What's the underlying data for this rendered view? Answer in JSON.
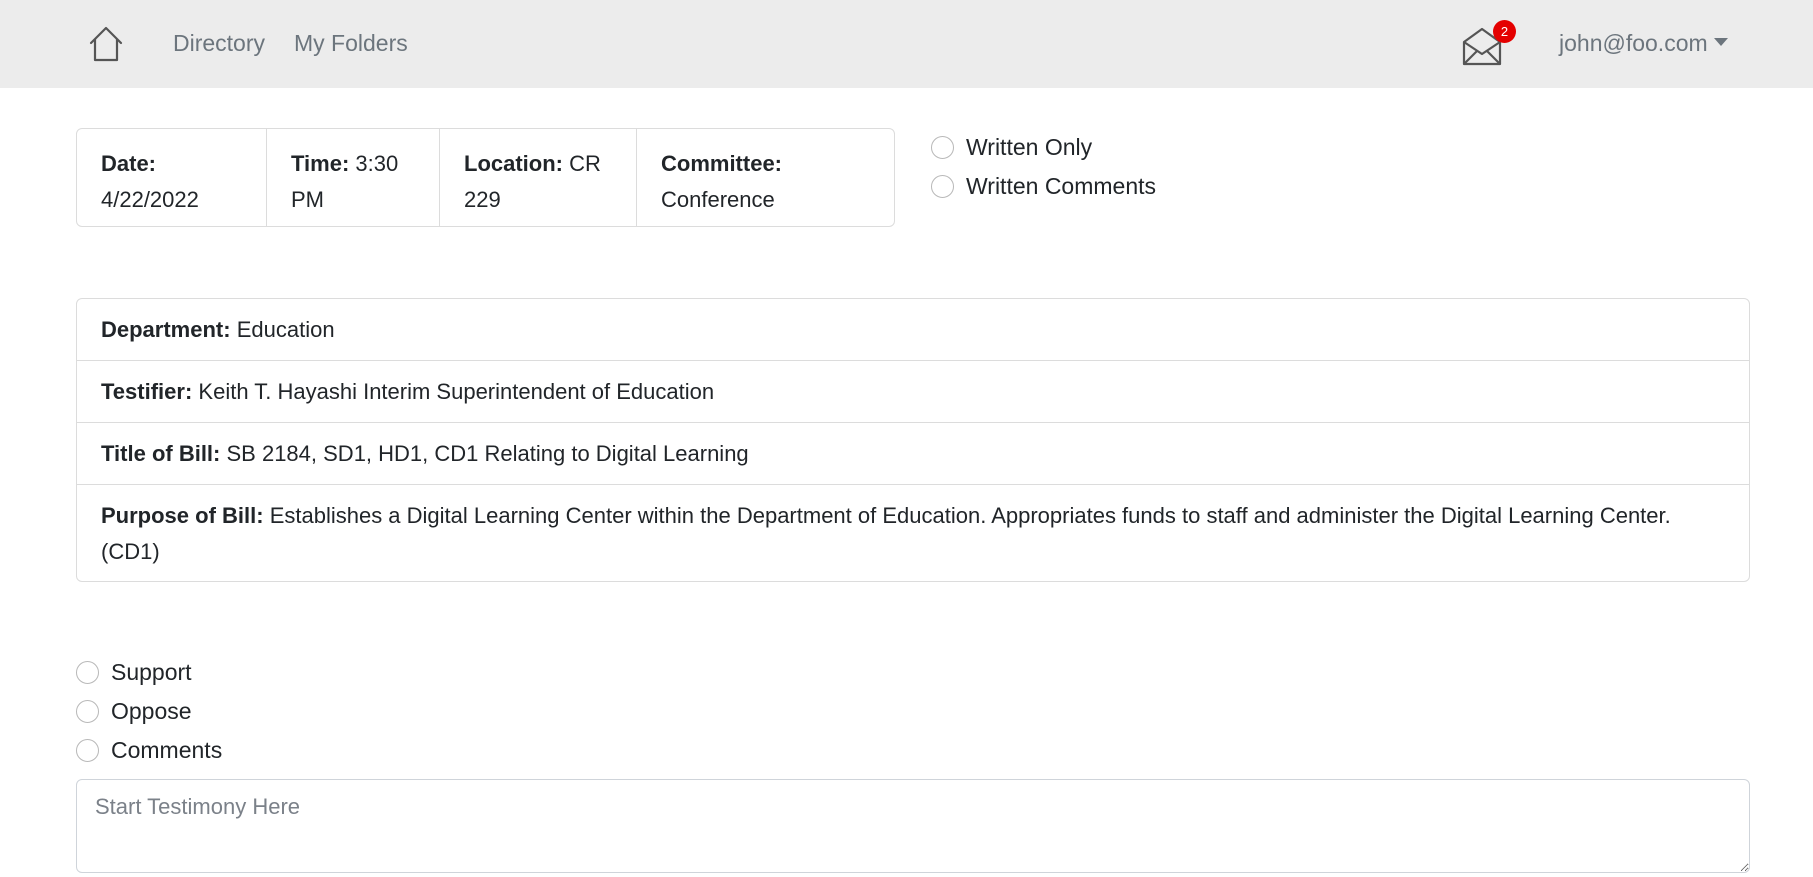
{
  "navbar": {
    "home_icon": "home-icon",
    "links": [
      "Directory",
      "My Folders"
    ],
    "mail_icon": "envelope-icon",
    "mail_badge": "2",
    "user": "john@foo.com"
  },
  "meeting": {
    "date_label": "Date:",
    "date": "4/22/2022",
    "time_label": "Time:",
    "time": "3:30 PM",
    "location_label": "Location:",
    "location": "CR 229",
    "committee_label": "Committee:",
    "committee": "Conference"
  },
  "testimony_type": {
    "options": [
      "Written Only",
      "Written Comments"
    ]
  },
  "bill": {
    "department_label": "Department:",
    "department": "Education",
    "testifier_label": "Testifier:",
    "testifier": "Keith T. Hayashi Interim Superintendent of Education",
    "title_label": "Title of Bill:",
    "title": "SB 2184, SD1, HD1, CD1 Relating to Digital Learning",
    "purpose_label": "Purpose of Bill:",
    "purpose": "Establishes a Digital Learning Center within the Department of Education. Appropriates funds to staff and administer the Digital Learning Center. (CD1)"
  },
  "position": {
    "options": [
      "Support",
      "Oppose",
      "Comments"
    ]
  },
  "testimony": {
    "placeholder": "Start Testimony Here",
    "value": ""
  },
  "colors": {
    "navbar_bg": "#ececec",
    "nav_text": "#6c757d",
    "badge": "#e40000",
    "border": "#dcdcdc"
  }
}
